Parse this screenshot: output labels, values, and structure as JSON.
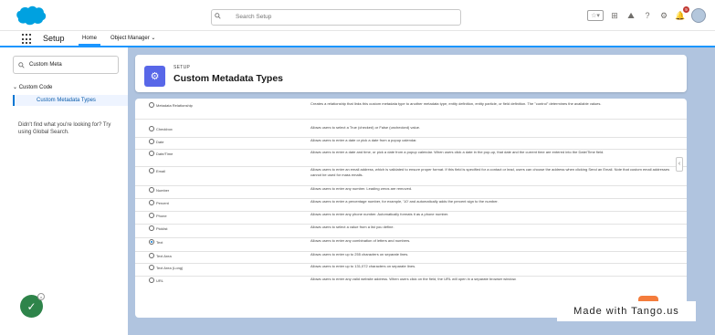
{
  "header": {
    "search_placeholder": "Search Setup",
    "favorites_icon": "star-icon",
    "notifications_count": "9"
  },
  "nav": {
    "app_name": "Setup",
    "tabs": [
      {
        "label": "Home",
        "active": true
      },
      {
        "label": "Object Manager",
        "active": false
      }
    ]
  },
  "sidebar": {
    "quick_find_value": "Custom Meta",
    "tree_heading": "Custom Code",
    "tree_item": "Custom Metadata Types",
    "not_found_text": "Didn't find what you're looking for? Try using Global Search."
  },
  "setup_header": {
    "label": "SETUP",
    "title": "Custom Metadata Types"
  },
  "field_types": [
    {
      "label": "Metadata Relationship",
      "desc": "Creates a relationship that links this custom metadata type to another metadata type, entity definition, entity particle, or field definition. The \"control\" determines the available values.",
      "checked": false
    },
    {
      "label": "Checkbox",
      "desc": "Allows users to select a True (checked) or False (unchecked) value.",
      "checked": false
    },
    {
      "label": "Date",
      "desc": "Allows users to enter a date or pick a date from a popup calendar.",
      "checked": false
    },
    {
      "label": "Date/Time",
      "desc": "Allows users to enter a date and time, or pick a date from a popup calendar. When users click a date in the pop-up, that date and the current time are entered into the Date/Time field.",
      "checked": false
    },
    {
      "label": "Email",
      "desc": "Allows users to enter an email address, which is validated to ensure proper format. If this field is specified for a contact or lead, users can choose the address when clicking Send an Email. Note that custom email addresses cannot be used for mass emails.",
      "checked": false
    },
    {
      "label": "Number",
      "desc": "Allows users to enter any number. Leading zeros are removed.",
      "checked": false
    },
    {
      "label": "Percent",
      "desc": "Allows users to enter a percentage number, for example, '10' and automatically adds the percent sign to the number.",
      "checked": false
    },
    {
      "label": "Phone",
      "desc": "Allows users to enter any phone number. Automatically formats it as a phone number.",
      "checked": false
    },
    {
      "label": "Picklist",
      "desc": "Allows users to select a value from a list you define.",
      "checked": false
    },
    {
      "label": "Text",
      "desc": "Allows users to enter any combination of letters and numbers.",
      "checked": true
    },
    {
      "label": "Text Area",
      "desc": "Allows users to enter up to 255 characters on separate lines.",
      "checked": false
    },
    {
      "label": "Text Area (Long)",
      "desc": "Allows users to enter up to 131,072 characters on separate lines.",
      "checked": false
    },
    {
      "label": "URL",
      "desc": "Allows users to enter any valid website address. When users click on the field, the URL will open in a separate browser window.",
      "checked": false
    }
  ],
  "watermark": "Made with Tango.us",
  "colors": {
    "brand_blue": "#0176d3",
    "salesforce_cloud": "#00a1e0",
    "setup_icon": "#5867e8",
    "page_bg": "#b0c4df",
    "success_green": "#2e844a"
  }
}
